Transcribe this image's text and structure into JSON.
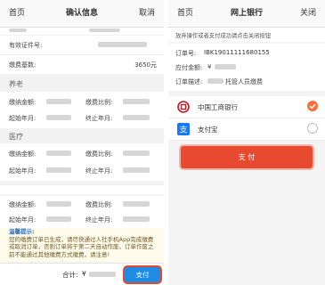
{
  "left_nav": {
    "home": "首页",
    "title": "确认信息",
    "cancel": "取消"
  },
  "id_row": {
    "label": "有效证件号:"
  },
  "base_row": {
    "label": "缴费基数:",
    "value": "3650元"
  },
  "pension": {
    "title": "养老",
    "amount_label": "缴纳金额:",
    "ratio_label": "缴费比例:",
    "start_label": "起始年月:",
    "end_label": "终止年月:"
  },
  "medical": {
    "title": "医疗",
    "amount_label": "缴纳金额:",
    "ratio_label": "缴费比例:",
    "start_label": "起始年月:",
    "end_label": "终止年月:"
  },
  "bottom": {
    "amount_label": "缴纳金额:",
    "ratio_label": "缴费比例:",
    "start_label": "起始年月:",
    "end_label": "终止年月:"
  },
  "notice": {
    "title": "温馨提示:",
    "text": "您的缴费订单已生成，请尽快通过人社手机App完成缴费或取消订单，否则订单将于第二天自动作废。订单作废之前不能通过其他缴费方式缴费，请注意!"
  },
  "footer": {
    "total_label": "合计:",
    "total_prefix": "¥",
    "pay": "支付"
  },
  "right_nav": {
    "home": "首页",
    "title": "网上银行",
    "close": "关闭"
  },
  "warning": "放弃操作或者支付成功请点击关闭按钮",
  "order": {
    "no_label": "订单号:",
    "no_value": "IBK19011111680155",
    "amount_label": "应付金额:",
    "amount_prefix": "¥",
    "desc_label": "订单描述:",
    "desc_suffix": "托管人员缴费"
  },
  "banks": [
    {
      "name": "中国工商银行",
      "icon": "icbc-icon",
      "selected": true,
      "color": "#c4161c"
    },
    {
      "name": "支付宝",
      "icon": "alipay-icon",
      "selected": false,
      "color": "#1677ff"
    }
  ],
  "pay_button": "支 付",
  "colors": {
    "pay_blue": "#1e8ce6",
    "pay_red": "#e84a2f",
    "accent_orange": "#ff6d3a",
    "notice_blue": "#2d6fc4"
  }
}
